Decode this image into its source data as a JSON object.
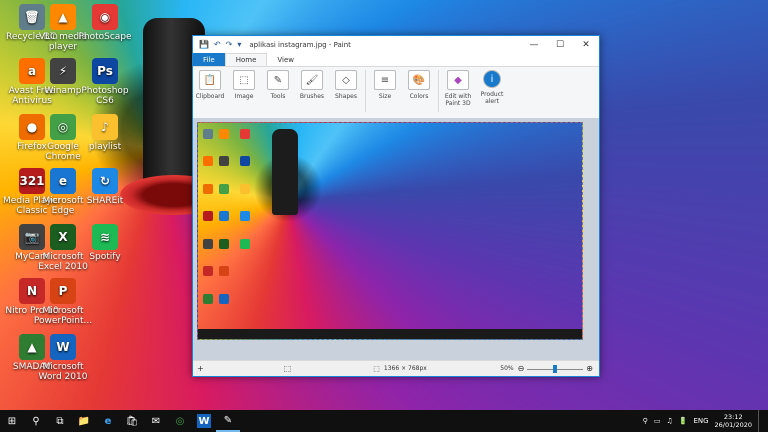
{
  "desktop": {
    "icons": [
      {
        "label": "Recycle Bin",
        "glyph": "🗑",
        "color": "#607d8b"
      },
      {
        "label": "VLC media player",
        "glyph": "▲",
        "color": "#ff8800"
      },
      {
        "label": "PhotoScape",
        "glyph": "◉",
        "color": "#e53935"
      },
      {
        "label": "Avast Free Antivirus",
        "glyph": "a",
        "color": "#ff6f00"
      },
      {
        "label": "Winamp",
        "glyph": "⚡",
        "color": "#424242"
      },
      {
        "label": "Photoshop CS6",
        "glyph": "Ps",
        "color": "#0d47a1"
      },
      {
        "label": "Firefox",
        "glyph": "●",
        "color": "#ef6c00"
      },
      {
        "label": "Google Chrome",
        "glyph": "◎",
        "color": "#43a047"
      },
      {
        "label": "playlist",
        "glyph": "♪",
        "color": "#fbc02d"
      },
      {
        "label": "Media Player Classic",
        "glyph": "321",
        "color": "#b71c1c"
      },
      {
        "label": "Microsoft Edge",
        "glyph": "e",
        "color": "#1976d2"
      },
      {
        "label": "SHAREit",
        "glyph": "↻",
        "color": "#1e88e5"
      },
      {
        "label": "MyCam",
        "glyph": "📷",
        "color": "#424242"
      },
      {
        "label": "Microsoft Excel 2010",
        "glyph": "X",
        "color": "#1b5e20"
      },
      {
        "label": "Spotify",
        "glyph": "≋",
        "color": "#1db954"
      },
      {
        "label": "Nitro Pro 10",
        "glyph": "N",
        "color": "#c62828"
      },
      {
        "label": "Microsoft PowerPoint...",
        "glyph": "P",
        "color": "#d84315"
      },
      {
        "label": "SMADAV",
        "glyph": "▲",
        "color": "#2e7d32"
      },
      {
        "label": "Microsoft Word 2010",
        "glyph": "W",
        "color": "#1565c0"
      }
    ]
  },
  "paint": {
    "title": "aplikasi instagram.jpg - Paint",
    "quick_access": [
      "💾",
      "↶",
      "↷",
      "▾"
    ],
    "window_controls": [
      "—",
      "☐",
      "✕"
    ],
    "tabs": {
      "file": "File",
      "home": "Home",
      "view": "View"
    },
    "ribbon": [
      {
        "label": "Clipboard",
        "glyph": "📋"
      },
      {
        "label": "Image",
        "glyph": "⬚"
      },
      {
        "label": "Tools",
        "glyph": "✎"
      },
      {
        "label": "Brushes",
        "glyph": "🖌"
      },
      {
        "label": "Shapes",
        "glyph": "◇"
      },
      {
        "label": "Size",
        "glyph": "≡"
      },
      {
        "label": "Colors",
        "glyph": "🎨"
      },
      {
        "label": "Edit with Paint 3D",
        "glyph": "◆"
      },
      {
        "label": "Product alert",
        "glyph": "i"
      }
    ],
    "status": {
      "dimensions": "1366 × 768px",
      "zoom": "50%",
      "zoom_out": "⊖",
      "zoom_in": "⊕",
      "zoom_level": 0.5
    }
  },
  "taskbar": {
    "start": "⊞",
    "search": "⚲",
    "taskview": "⧉",
    "apps": [
      "📁",
      "e",
      "🛍",
      "✉",
      "◎",
      "W",
      "✎"
    ],
    "tray_icons": [
      "⚲",
      "▭",
      "♫",
      "🔋"
    ],
    "language": "ENG",
    "time": "23:12",
    "date": "26/01/2020"
  }
}
